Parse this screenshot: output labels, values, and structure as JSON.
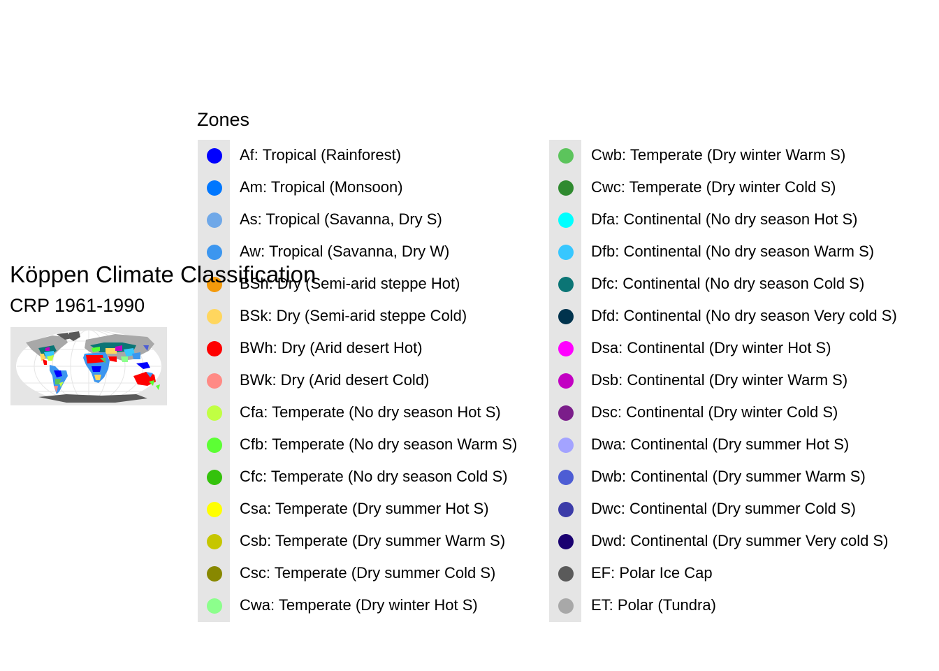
{
  "title": "Köppen Climate Classification",
  "subtitle": "CRP 1961-1990",
  "legend": {
    "title": "Zones",
    "columns": [
      [
        {
          "label": "Af: Tropical (Rainforest)",
          "color": "#0000fe"
        },
        {
          "label": "Am: Tropical (Monsoon)",
          "color": "#0077ff"
        },
        {
          "label": "As: Tropical (Savanna, Dry S)",
          "color": "#6fa8e8"
        },
        {
          "label": "Aw: Tropical (Savanna, Dry W)",
          "color": "#3c96ef"
        },
        {
          "label": "BSh: Dry (Semi-arid steppe Hot)",
          "color": "#f49a0b"
        },
        {
          "label": "BSk: Dry (Semi-arid steppe Cold)",
          "color": "#ffd65e"
        },
        {
          "label": "BWh: Dry (Arid desert Hot)",
          "color": "#fe0000"
        },
        {
          "label": "BWk: Dry (Arid desert Cold)",
          "color": "#ff8a85"
        },
        {
          "label": "Cfa: Temperate (No dry season Hot S)",
          "color": "#c1ff43"
        },
        {
          "label": "Cfb: Temperate (No dry season Warm S)",
          "color": "#5cff34"
        },
        {
          "label": "Cfc: Temperate (No dry season Cold S)",
          "color": "#34c20b"
        },
        {
          "label": "Csa: Temperate (Dry summer Hot S)",
          "color": "#ffff00"
        },
        {
          "label": "Csb: Temperate (Dry summer Warm S)",
          "color": "#c6c600"
        },
        {
          "label": "Csc: Temperate (Dry summer Cold S)",
          "color": "#888800"
        },
        {
          "label": "Cwa: Temperate (Dry winter Hot S)",
          "color": "#8cff8c"
        }
      ],
      [
        {
          "label": "Cwb: Temperate (Dry winter Warm S)",
          "color": "#5cc45c"
        },
        {
          "label": "Cwc: Temperate (Dry winter Cold S)",
          "color": "#2f8a2f"
        },
        {
          "label": "Dfa: Continental (No dry season Hot S)",
          "color": "#00ffff"
        },
        {
          "label": "Dfb: Continental (No dry season Warm S)",
          "color": "#37c7ff"
        },
        {
          "label": "Dfc: Continental (No dry season Cold S)",
          "color": "#0b7575"
        },
        {
          "label": "Dfd: Continental (No dry season Very cold S)",
          "color": "#00334d"
        },
        {
          "label": "Dsa: Continental (Dry winter Hot S)",
          "color": "#ff00ff"
        },
        {
          "label": "Dsb: Continental (Dry winter Warm S)",
          "color": "#c200c2"
        },
        {
          "label": "Dsc: Continental (Dry winter Cold S)",
          "color": "#7b1d8a"
        },
        {
          "label": "Dwa: Continental (Dry summer Hot S)",
          "color": "#a3a3ff"
        },
        {
          "label": "Dwb: Continental (Dry summer Warm S)",
          "color": "#4d5dd4"
        },
        {
          "label": "Dwc: Continental (Dry summer Cold S)",
          "color": "#3b3ba8"
        },
        {
          "label": "Dwd: Continental (Dry summer Very cold S)",
          "color": "#1a0070"
        },
        {
          "label": "EF: Polar Ice Cap",
          "color": "#5a5a5a"
        },
        {
          "label": "ET: Polar (Tundra)",
          "color": "#a8a8a8"
        }
      ]
    ]
  },
  "map": {
    "panel_color": "#e5e5e5",
    "ocean_color": "#ffffff"
  }
}
